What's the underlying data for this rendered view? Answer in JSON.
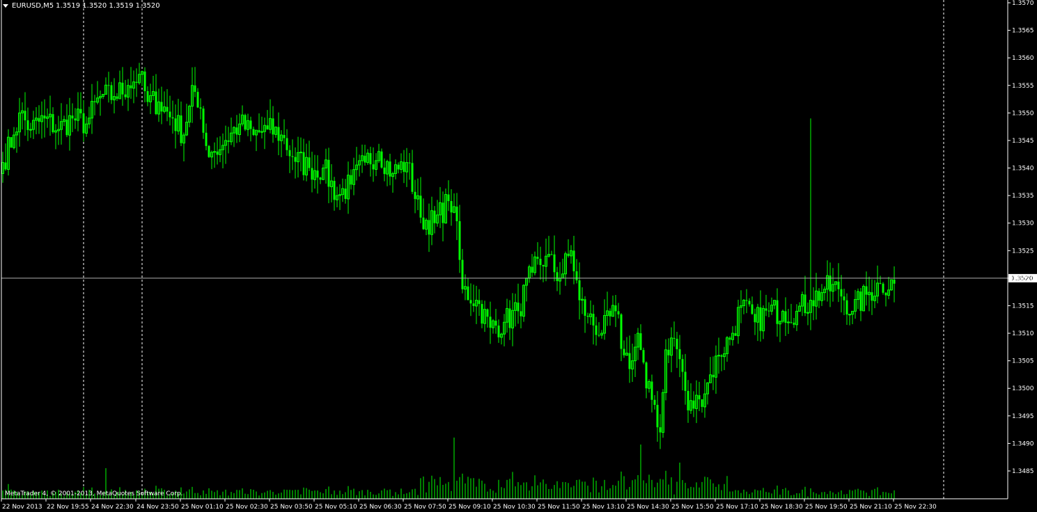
{
  "window": {
    "symbol_label": "EURUSD,M5",
    "ohlc_label": "1.3519 1.3520 1.3519 1.3520",
    "copyright": "MetaTrader 4, © 2001-2013, MetaQuotes Software Corp.",
    "current_price": "1.3520"
  },
  "colors": {
    "background": "#000000",
    "candle": "#00ff00",
    "axis": "#ffffff",
    "bid_line": "#b0b0b0",
    "price_tag_bg": "#ffffff",
    "price_tag_text": "#000000"
  },
  "chart_data": {
    "type": "candlestick",
    "ylim": [
      1.3485,
      1.357
    ],
    "y_ticks": [
      "1.3570",
      "1.3565",
      "1.3560",
      "1.3555",
      "1.3550",
      "1.3545",
      "1.3540",
      "1.3535",
      "1.3530",
      "1.3525",
      "1.3520",
      "1.3515",
      "1.3510",
      "1.3505",
      "1.3500",
      "1.3495",
      "1.3490",
      "1.3485"
    ],
    "x_ticks": [
      "22 Nov 2013",
      "22 Nov 19:55",
      "24 Nov 22:30",
      "24 Nov 23:50",
      "25 Nov 01:10",
      "25 Nov 02:30",
      "25 Nov 03:50",
      "25 Nov 05:10",
      "25 Nov 06:30",
      "25 Nov 07:50",
      "25 Nov 09:10",
      "25 Nov 10:30",
      "25 Nov 11:50",
      "25 Nov 13:10",
      "25 Nov 14:30",
      "25 Nov 15:50",
      "25 Nov 17:10",
      "25 Nov 18:30",
      "25 Nov 19:50",
      "25 Nov 21:10",
      "25 Nov 22:30"
    ],
    "period_separators": [
      "22 Nov 19:55",
      "24 Nov 23:50",
      "25 Nov 22:30"
    ],
    "bid": 1.352,
    "anchors": [
      [
        0,
        1.3541
      ],
      [
        4,
        1.3546
      ],
      [
        6,
        1.355
      ],
      [
        10,
        1.3547
      ],
      [
        15,
        1.3549
      ],
      [
        20,
        1.3547
      ],
      [
        25,
        1.3549
      ],
      [
        30,
        1.3548
      ],
      [
        35,
        1.3553
      ],
      [
        40,
        1.3553
      ],
      [
        45,
        1.3555
      ],
      [
        49,
        1.3557
      ],
      [
        52,
        1.3552
      ],
      [
        56,
        1.3552
      ],
      [
        61,
        1.3549
      ],
      [
        65,
        1.3546
      ],
      [
        68,
        1.3555
      ],
      [
        70,
        1.3551
      ],
      [
        73,
        1.3544
      ],
      [
        76,
        1.3543
      ],
      [
        80,
        1.3545
      ],
      [
        85,
        1.3548
      ],
      [
        90,
        1.3546
      ],
      [
        95,
        1.3547
      ],
      [
        100,
        1.3546
      ],
      [
        104,
        1.3542
      ],
      [
        110,
        1.354
      ],
      [
        115,
        1.354
      ],
      [
        120,
        1.3535
      ],
      [
        125,
        1.3537
      ],
      [
        130,
        1.3541
      ],
      [
        135,
        1.3543
      ],
      [
        140,
        1.3539
      ],
      [
        145,
        1.3541
      ],
      [
        150,
        1.3531
      ],
      [
        155,
        1.353
      ],
      [
        160,
        1.3534
      ],
      [
        162,
        1.3533
      ],
      [
        165,
        1.3518
      ],
      [
        170,
        1.3516
      ],
      [
        175,
        1.3511
      ],
      [
        180,
        1.3512
      ],
      [
        185,
        1.3514
      ],
      [
        190,
        1.3521
      ],
      [
        195,
        1.3524
      ],
      [
        200,
        1.352
      ],
      [
        204,
        1.3525
      ],
      [
        207,
        1.3516
      ],
      [
        210,
        1.3513
      ],
      [
        215,
        1.351
      ],
      [
        220,
        1.3514
      ],
      [
        223,
        1.3506
      ],
      [
        226,
        1.3505
      ],
      [
        228,
        1.351
      ],
      [
        231,
        1.35
      ],
      [
        234,
        1.3497
      ],
      [
        236,
        1.3492
      ],
      [
        238,
        1.3507
      ],
      [
        241,
        1.3509
      ],
      [
        244,
        1.3503
      ],
      [
        246,
        1.3496
      ],
      [
        250,
        1.3498
      ],
      [
        253,
        1.3501
      ],
      [
        257,
        1.3506
      ],
      [
        262,
        1.351
      ],
      [
        265,
        1.3515
      ],
      [
        270,
        1.3512
      ],
      [
        275,
        1.3514
      ],
      [
        280,
        1.3514
      ],
      [
        285,
        1.3514
      ],
      [
        290,
        1.3516
      ],
      [
        295,
        1.3518
      ],
      [
        300,
        1.3518
      ],
      [
        305,
        1.3514
      ],
      [
        310,
        1.3517
      ],
      [
        315,
        1.3519
      ],
      [
        320,
        1.3519
      ]
    ]
  }
}
